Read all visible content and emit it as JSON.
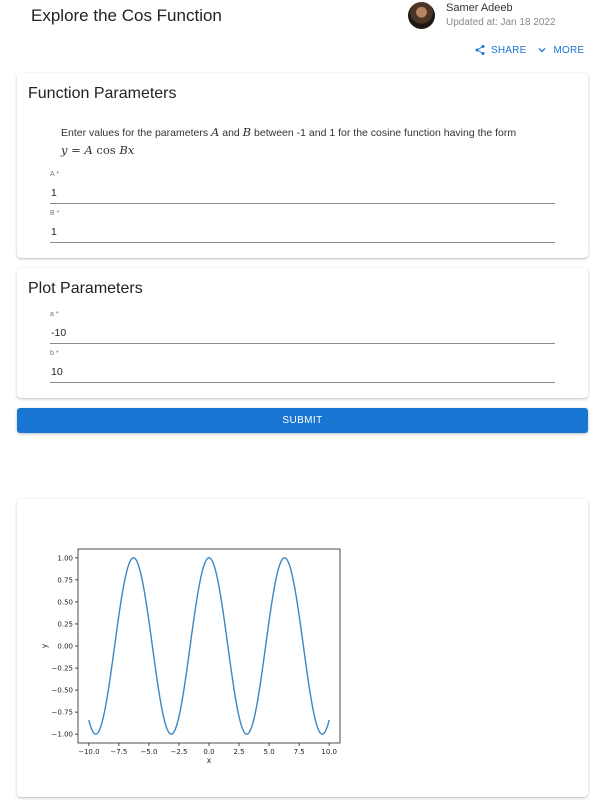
{
  "header": {
    "title": "Explore the Cos Function",
    "author_name": "Samer Adeeb",
    "updated": "Updated at: Jan 18 2022",
    "share_label": "SHARE",
    "more_label": "MORE"
  },
  "function_card": {
    "title": "Function Parameters",
    "desc_part1": "Enter values for the parameters ",
    "param_a": "A",
    "desc_and": " and ",
    "param_b": "B",
    "desc_part2": "  between -1 and 1 for the cosine function having the form",
    "formula_y": "y",
    "formula_eq": " = ",
    "formula_A": "A",
    "formula_cos": " cos ",
    "formula_Bx": "Bx",
    "fields": [
      {
        "label": "A *",
        "value": "1"
      },
      {
        "label": "B *",
        "value": "1"
      }
    ]
  },
  "plot_card": {
    "title": "Plot Parameters",
    "fields": [
      {
        "label": "a *",
        "value": "-10"
      },
      {
        "label": "b *",
        "value": "10"
      }
    ]
  },
  "submit_label": "SUBMIT",
  "colors": {
    "accent": "#1976d2",
    "line": "#3b87c2"
  },
  "icons": {
    "share": "share-icon",
    "more": "chevron-down-icon"
  },
  "chart_data": {
    "type": "line",
    "function": "y = A cos(B x)",
    "A": 1,
    "B": 1,
    "xlim": [
      -10,
      10
    ],
    "ylim": [
      -1.0,
      1.0
    ],
    "xlabel": "x",
    "ylabel": "y",
    "xticks": [
      -10.0,
      -7.5,
      -5.0,
      -2.5,
      0.0,
      2.5,
      5.0,
      7.5,
      10.0
    ],
    "xtick_labels": [
      "−10.0",
      "−7.5",
      "−5.0",
      "−2.5",
      "0.0",
      "2.5",
      "5.0",
      "7.5",
      "10.0"
    ],
    "yticks": [
      -1.0,
      -0.75,
      -0.5,
      -0.25,
      0.0,
      0.25,
      0.5,
      0.75,
      1.0
    ],
    "ytick_labels": [
      "−1.00",
      "−0.75",
      "−0.50",
      "−0.25",
      "0.00",
      "0.25",
      "0.50",
      "0.75",
      "1.00"
    ],
    "grid": false,
    "legend": "none"
  }
}
